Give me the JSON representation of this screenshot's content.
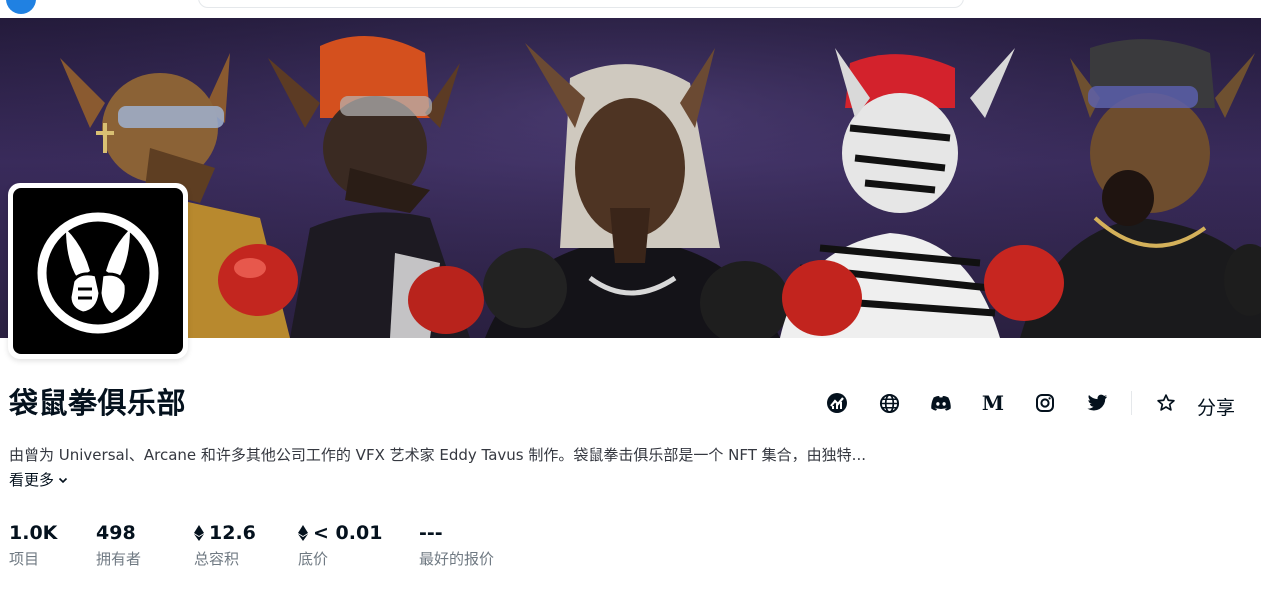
{
  "collection": {
    "name": "袋鼠拳俱乐部",
    "description": "由曾为 Universal、Arcane 和许多其他公司工作的 VFX 艺术家 Eddy Tavus 制作。袋鼠拳击俱乐部是一个 NFT 集合，由独特...",
    "see_more_label": "看更多"
  },
  "actions": {
    "icons": [
      "activity-icon",
      "globe-icon",
      "discord-icon",
      "medium-icon",
      "instagram-icon",
      "twitter-icon",
      "star-icon"
    ],
    "share_label": "分享"
  },
  "stats": [
    {
      "value": "1.0K",
      "label": "项目",
      "eth": false
    },
    {
      "value": "498",
      "label": "拥有者",
      "eth": false
    },
    {
      "value": "12.6",
      "label": "总容积",
      "eth": true
    },
    {
      "value": "< 0.01",
      "label": "底价",
      "eth": true
    },
    {
      "value": "---",
      "label": "最好的报价",
      "eth": false
    }
  ],
  "colors": {
    "text": "#04111d",
    "muted": "#707a83",
    "accent": "#2081e2",
    "banner_bg": "#2e2349"
  }
}
